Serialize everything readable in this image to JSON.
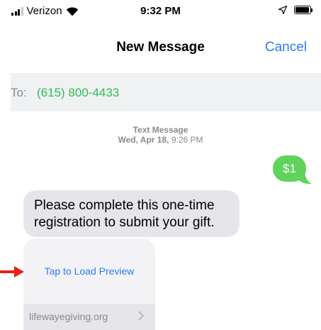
{
  "status_bar": {
    "carrier": "Verizon",
    "time": "9:32 PM",
    "signal_bars_filled": 3,
    "signal_bars_total": 4,
    "icons": [
      "signal-icon",
      "wifi-icon",
      "location-icon",
      "battery-icon"
    ]
  },
  "nav": {
    "title": "New Message",
    "cancel_label": "Cancel"
  },
  "recipient": {
    "label": "To:",
    "value": "(615) 800-4433"
  },
  "thread": {
    "timestamp_type": "Text Message",
    "timestamp_day": "Wed, Apr 18,",
    "timestamp_time": "9:26 PM",
    "sent_message": "$1",
    "received_message": "Please complete this one-time registration to submit your gift.",
    "preview": {
      "tap_label": "Tap to Load Preview",
      "domain": "lifewayegiving.org"
    }
  },
  "colors": {
    "accent_blue": "#2f7cf6",
    "sms_green": "#5fd35c",
    "recipient_green": "#2dbe55",
    "bubble_gray": "#e6e6ea",
    "annotation_red": "#e8211b"
  }
}
